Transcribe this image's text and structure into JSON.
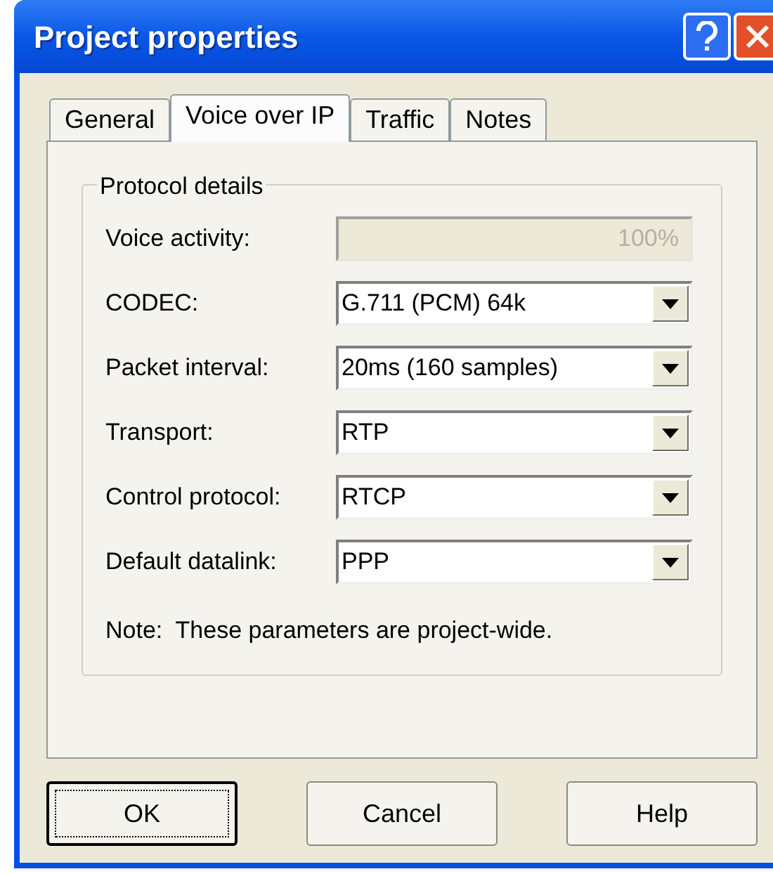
{
  "window": {
    "title": "Project properties"
  },
  "tabs": [
    {
      "label": "General",
      "selected": false
    },
    {
      "label": "Voice over IP",
      "selected": true
    },
    {
      "label": "Traffic",
      "selected": false
    },
    {
      "label": "Notes",
      "selected": false
    }
  ],
  "group": {
    "title": "Protocol details",
    "fields": [
      {
        "label": "Voice activity:",
        "kind": "text",
        "value": "100%",
        "disabled": true
      },
      {
        "label": "CODEC:",
        "kind": "dropdown",
        "value": "G.711 (PCM) 64k"
      },
      {
        "label": "Packet interval:",
        "kind": "dropdown",
        "value": "20ms (160 samples)"
      },
      {
        "label": "Transport:",
        "kind": "dropdown",
        "value": "RTP"
      },
      {
        "label": "Control protocol:",
        "kind": "dropdown",
        "value": "RTCP"
      },
      {
        "label": "Default datalink:",
        "kind": "dropdown",
        "value": "PPP"
      }
    ],
    "note": "Note:  These parameters are project-wide."
  },
  "buttons": [
    {
      "label": "OK",
      "default": true
    },
    {
      "label": "Cancel",
      "default": false
    },
    {
      "label": "Help",
      "default": false
    }
  ]
}
